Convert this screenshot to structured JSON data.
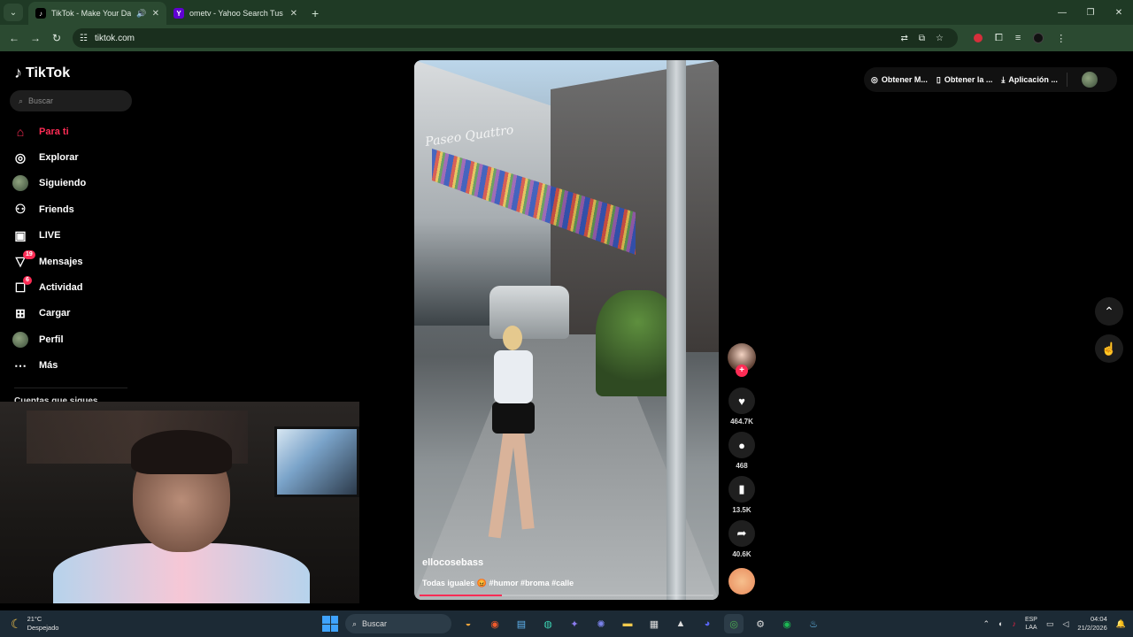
{
  "browser": {
    "tabs": [
      {
        "title": "TikTok - Make Your Day",
        "active": true
      },
      {
        "title": "ometv - Yahoo Search Tus resul",
        "active": false
      }
    ],
    "url": "tiktok.com"
  },
  "sidebar": {
    "brand": "TikTok",
    "search_placeholder": "Buscar",
    "items": [
      {
        "label": "Para ti",
        "icon": "home-icon",
        "active": true
      },
      {
        "label": "Explorar",
        "icon": "compass-icon"
      },
      {
        "label": "Siguiendo",
        "icon": "avatar-icon"
      },
      {
        "label": "Friends",
        "icon": "friends-icon"
      },
      {
        "label": "LIVE",
        "icon": "live-icon"
      },
      {
        "label": "Mensajes",
        "icon": "messages-icon",
        "badge": "19"
      },
      {
        "label": "Actividad",
        "icon": "activity-icon",
        "badge": "6"
      },
      {
        "label": "Cargar",
        "icon": "upload-icon"
      },
      {
        "label": "Perfil",
        "icon": "profile-icon"
      },
      {
        "label": "Más",
        "icon": "more-icon"
      }
    ],
    "following_heading": "Cuentas que sigues"
  },
  "video": {
    "overlay_text": "Paseo Quattro",
    "author": "ellocosebass",
    "caption": "Todas iguales 😡 #humor #broma #calle",
    "progress": 0.28
  },
  "actions": {
    "likes": "464.7K",
    "comments": "468",
    "saves": "13.5K",
    "shares": "40.6K"
  },
  "topbar": {
    "item1": "Obtener M...",
    "item2": "Obtener la ...",
    "item3": "Aplicación ..."
  },
  "taskbar": {
    "temp": "21°C",
    "weather": "Despejado",
    "search": "Buscar",
    "lang1": "ESP",
    "lang2": "LAA",
    "time": "04:04",
    "date": "21/2/2026"
  },
  "colors": {
    "accent": "#fe2c55",
    "chrome": "#2b4a31"
  }
}
